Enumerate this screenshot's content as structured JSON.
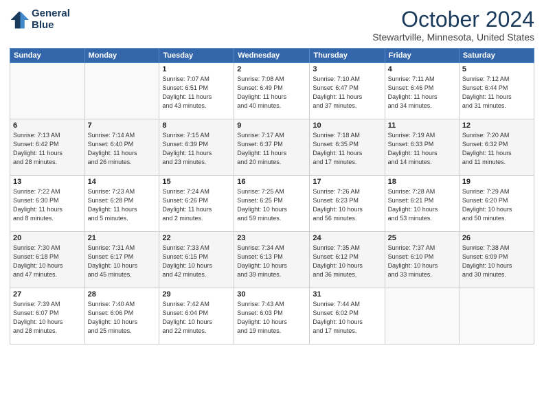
{
  "header": {
    "logo_line1": "General",
    "logo_line2": "Blue",
    "month_title": "October 2024",
    "location": "Stewartville, Minnesota, United States"
  },
  "weekdays": [
    "Sunday",
    "Monday",
    "Tuesday",
    "Wednesday",
    "Thursday",
    "Friday",
    "Saturday"
  ],
  "weeks": [
    [
      {
        "day": "",
        "info": ""
      },
      {
        "day": "",
        "info": ""
      },
      {
        "day": "1",
        "info": "Sunrise: 7:07 AM\nSunset: 6:51 PM\nDaylight: 11 hours\nand 43 minutes."
      },
      {
        "day": "2",
        "info": "Sunrise: 7:08 AM\nSunset: 6:49 PM\nDaylight: 11 hours\nand 40 minutes."
      },
      {
        "day": "3",
        "info": "Sunrise: 7:10 AM\nSunset: 6:47 PM\nDaylight: 11 hours\nand 37 minutes."
      },
      {
        "day": "4",
        "info": "Sunrise: 7:11 AM\nSunset: 6:46 PM\nDaylight: 11 hours\nand 34 minutes."
      },
      {
        "day": "5",
        "info": "Sunrise: 7:12 AM\nSunset: 6:44 PM\nDaylight: 11 hours\nand 31 minutes."
      }
    ],
    [
      {
        "day": "6",
        "info": "Sunrise: 7:13 AM\nSunset: 6:42 PM\nDaylight: 11 hours\nand 28 minutes."
      },
      {
        "day": "7",
        "info": "Sunrise: 7:14 AM\nSunset: 6:40 PM\nDaylight: 11 hours\nand 26 minutes."
      },
      {
        "day": "8",
        "info": "Sunrise: 7:15 AM\nSunset: 6:39 PM\nDaylight: 11 hours\nand 23 minutes."
      },
      {
        "day": "9",
        "info": "Sunrise: 7:17 AM\nSunset: 6:37 PM\nDaylight: 11 hours\nand 20 minutes."
      },
      {
        "day": "10",
        "info": "Sunrise: 7:18 AM\nSunset: 6:35 PM\nDaylight: 11 hours\nand 17 minutes."
      },
      {
        "day": "11",
        "info": "Sunrise: 7:19 AM\nSunset: 6:33 PM\nDaylight: 11 hours\nand 14 minutes."
      },
      {
        "day": "12",
        "info": "Sunrise: 7:20 AM\nSunset: 6:32 PM\nDaylight: 11 hours\nand 11 minutes."
      }
    ],
    [
      {
        "day": "13",
        "info": "Sunrise: 7:22 AM\nSunset: 6:30 PM\nDaylight: 11 hours\nand 8 minutes."
      },
      {
        "day": "14",
        "info": "Sunrise: 7:23 AM\nSunset: 6:28 PM\nDaylight: 11 hours\nand 5 minutes."
      },
      {
        "day": "15",
        "info": "Sunrise: 7:24 AM\nSunset: 6:26 PM\nDaylight: 11 hours\nand 2 minutes."
      },
      {
        "day": "16",
        "info": "Sunrise: 7:25 AM\nSunset: 6:25 PM\nDaylight: 10 hours\nand 59 minutes."
      },
      {
        "day": "17",
        "info": "Sunrise: 7:26 AM\nSunset: 6:23 PM\nDaylight: 10 hours\nand 56 minutes."
      },
      {
        "day": "18",
        "info": "Sunrise: 7:28 AM\nSunset: 6:21 PM\nDaylight: 10 hours\nand 53 minutes."
      },
      {
        "day": "19",
        "info": "Sunrise: 7:29 AM\nSunset: 6:20 PM\nDaylight: 10 hours\nand 50 minutes."
      }
    ],
    [
      {
        "day": "20",
        "info": "Sunrise: 7:30 AM\nSunset: 6:18 PM\nDaylight: 10 hours\nand 47 minutes."
      },
      {
        "day": "21",
        "info": "Sunrise: 7:31 AM\nSunset: 6:17 PM\nDaylight: 10 hours\nand 45 minutes."
      },
      {
        "day": "22",
        "info": "Sunrise: 7:33 AM\nSunset: 6:15 PM\nDaylight: 10 hours\nand 42 minutes."
      },
      {
        "day": "23",
        "info": "Sunrise: 7:34 AM\nSunset: 6:13 PM\nDaylight: 10 hours\nand 39 minutes."
      },
      {
        "day": "24",
        "info": "Sunrise: 7:35 AM\nSunset: 6:12 PM\nDaylight: 10 hours\nand 36 minutes."
      },
      {
        "day": "25",
        "info": "Sunrise: 7:37 AM\nSunset: 6:10 PM\nDaylight: 10 hours\nand 33 minutes."
      },
      {
        "day": "26",
        "info": "Sunrise: 7:38 AM\nSunset: 6:09 PM\nDaylight: 10 hours\nand 30 minutes."
      }
    ],
    [
      {
        "day": "27",
        "info": "Sunrise: 7:39 AM\nSunset: 6:07 PM\nDaylight: 10 hours\nand 28 minutes."
      },
      {
        "day": "28",
        "info": "Sunrise: 7:40 AM\nSunset: 6:06 PM\nDaylight: 10 hours\nand 25 minutes."
      },
      {
        "day": "29",
        "info": "Sunrise: 7:42 AM\nSunset: 6:04 PM\nDaylight: 10 hours\nand 22 minutes."
      },
      {
        "day": "30",
        "info": "Sunrise: 7:43 AM\nSunset: 6:03 PM\nDaylight: 10 hours\nand 19 minutes."
      },
      {
        "day": "31",
        "info": "Sunrise: 7:44 AM\nSunset: 6:02 PM\nDaylight: 10 hours\nand 17 minutes."
      },
      {
        "day": "",
        "info": ""
      },
      {
        "day": "",
        "info": ""
      }
    ]
  ]
}
